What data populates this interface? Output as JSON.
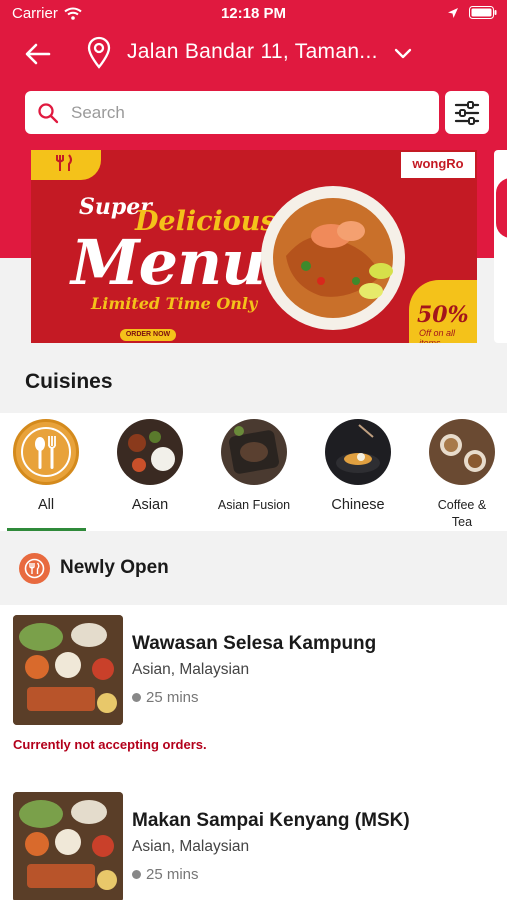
{
  "status_bar": {
    "carrier": "Carrier",
    "time": "12:18 PM"
  },
  "header": {
    "location": "Jalan Bandar 11, Taman..."
  },
  "search": {
    "placeholder": "Search"
  },
  "banner": {
    "logo": "wongRo",
    "line1": "Super",
    "line2": "Delicious",
    "line3": "Menu",
    "line4": "Limited Time Only",
    "cta": "ORDER NOW",
    "offer": "50%",
    "offer_note": "Off on all items"
  },
  "cuisines": {
    "title": "Cuisines",
    "items": [
      {
        "label": "All",
        "selected": true
      },
      {
        "label": "Asian"
      },
      {
        "label": "Asian Fusion"
      },
      {
        "label": "Chinese"
      },
      {
        "label": "Coffee & Tea"
      }
    ]
  },
  "newly_open": {
    "title": "Newly Open",
    "restaurants": [
      {
        "name": "Wawasan Selesa Kampung",
        "cuisine": "Asian, Malaysian",
        "time": "25 mins",
        "status": "Currently not accepting orders."
      },
      {
        "name": "Makan Sampai Kenyang (MSK)",
        "cuisine": "Asian, Malaysian",
        "time": "25 mins"
      }
    ]
  },
  "colors": {
    "brand": "#e0193f",
    "selected_underline": "#2f8a3a",
    "status_red": "#b3001b"
  }
}
